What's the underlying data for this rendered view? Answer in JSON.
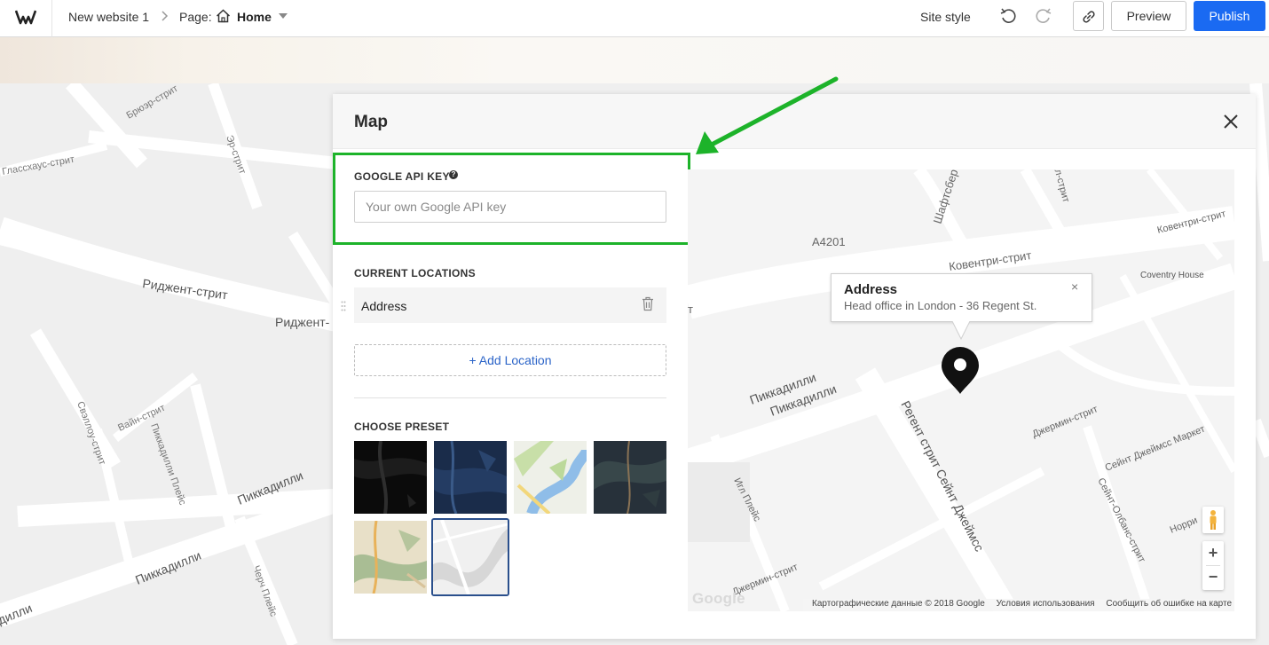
{
  "topbar": {
    "site_name": "New website 1",
    "page_label": "Page:",
    "page_name": "Home",
    "site_style": "Site style",
    "preview": "Preview",
    "publish": "Publish"
  },
  "panel": {
    "title": "Map",
    "api_key_label": "GOOGLE API KEY",
    "api_key_placeholder": "Your own Google API key",
    "api_key_value": "",
    "current_locations_label": "CURRENT LOCATIONS",
    "locations": [
      {
        "name": "Address"
      }
    ],
    "add_location": "+ Add Location",
    "choose_preset_label": "CHOOSE PRESET",
    "presets": [
      {
        "theme": "dark-black"
      },
      {
        "theme": "navy-blue"
      },
      {
        "theme": "light-green-blue"
      },
      {
        "theme": "dark-slate"
      },
      {
        "theme": "vintage-beige"
      },
      {
        "theme": "light-gray",
        "selected": true
      }
    ]
  },
  "preview_map": {
    "info_title": "Address",
    "info_subtitle": "Head office in London - 36 Regent St.",
    "info_close": "×",
    "zoom_in": "+",
    "zoom_out": "−",
    "google_logo": "Google",
    "footer_data": "Картографические данные © 2018 Google",
    "footer_terms": "Условия использования",
    "footer_report": "Сообщить об ошибке на карте",
    "street_labels": [
      "A4201",
      "Шафтсбер",
      "Ковентри-стрит",
      "Ковентри-стрит",
      "Coventry House",
      "Пиккадилли",
      "Пиккадилли",
      "Регент стрит Сейнт Джеймсс",
      "Джермин-стрит",
      "Сейнт Джеймсс Маркет",
      "Сейнт-Олбанс-стрит",
      "Игл Плейс",
      "Джермин-стрит",
      "Норри",
      "ил-стрит",
      "т"
    ]
  },
  "background_map": {
    "street_labels": [
      "Брюэр-стрит",
      "Эр-стрит",
      "Глассхаус-стрит",
      "Риджент-стрит",
      "Риджент-",
      "Свэллоу-стрит",
      "Вайн-стрит",
      "Пиккадилли Плейс",
      "Пиккадилли",
      "Пиккадилли",
      "Черч Плейс",
      "дилли"
    ]
  },
  "colors": {
    "accent": "#1a6af2",
    "highlight": "#1db32a",
    "link": "#2b64c8"
  }
}
